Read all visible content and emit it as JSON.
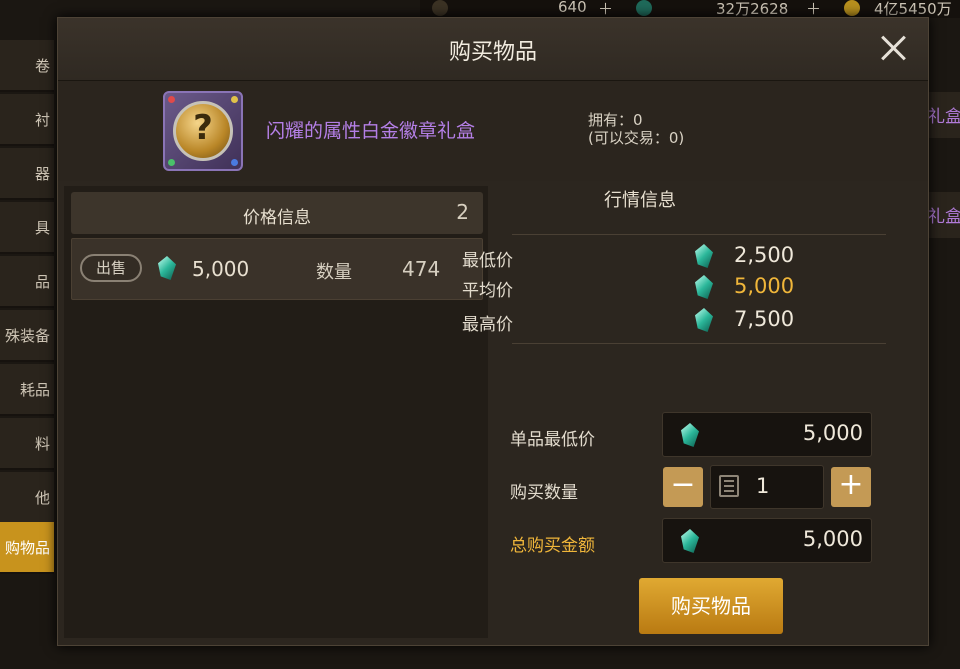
{
  "topbar": {
    "currency1": "640",
    "currency2": "32万2628",
    "currency3": "4亿5450万"
  },
  "leftnav": [
    {
      "label": "卷"
    },
    {
      "label": "衬"
    },
    {
      "label": "器"
    },
    {
      "label": "具"
    },
    {
      "label": "品"
    },
    {
      "label": "殊装备"
    },
    {
      "label": "耗品"
    },
    {
      "label": "料"
    },
    {
      "label": "他"
    },
    {
      "label": "购物品"
    }
  ],
  "bg_right": [
    {
      "label": "礼盒"
    },
    {
      "label": "礼盒"
    }
  ],
  "dialog": {
    "title": "购买物品",
    "item": {
      "name": "闪耀的属性白金徽章礼盒",
      "owned": "拥有：0",
      "tradable": "(可以交易：0)"
    },
    "price_info": {
      "header": "价格信息",
      "count": "2",
      "listings": [
        {
          "action": "出售",
          "price": "5,000",
          "qty_label": "数量",
          "qty": "474"
        }
      ]
    },
    "market": {
      "title": "行情信息",
      "stats": [
        {
          "label": "最低价",
          "value": "2,500",
          "color": "#efe8da"
        },
        {
          "label": "平均价",
          "value": "5,000",
          "color": "#f0b63a"
        },
        {
          "label": "最高价",
          "value": "7,500",
          "color": "#efe8da"
        }
      ]
    },
    "form": {
      "unit_price_label": "单品最低价",
      "unit_price": "5,000",
      "qty_label": "购买数量",
      "qty": "1",
      "total_label": "总购买金额",
      "total": "5,000"
    },
    "buy_label": "购买物品"
  },
  "colors": {
    "accent": "#c8931d",
    "item_name": "#b47fe6",
    "gold_text": "#f0b63a"
  }
}
